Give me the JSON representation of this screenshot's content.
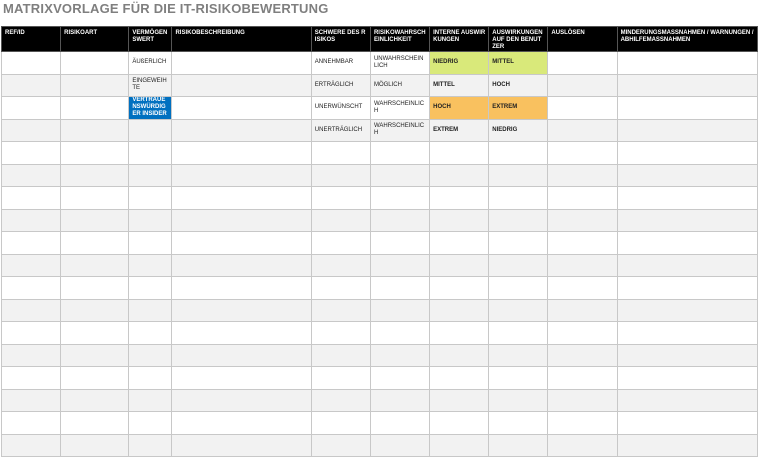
{
  "title": "MATRIXVORLAGE FÜR DIE IT-RISIKOBEWERTUNG",
  "headers": [
    "REF/ID",
    "RISIKOART",
    "VERMÖGENSWERT",
    "RISIKOBESCHREIBUNG",
    "SCHWERE DES RISIKOS",
    "RISIKOWAHRSCHEINLICHKEIT",
    "INTERNE AUSWIRKUNGEN",
    "AUSWIRKUNGEN AUF DEN BENUTZER",
    "AUSLÖSEN",
    "MINDERUNGSMASSNAHMEN / WARNUNGEN / ABHILFEMASSNAHMEN"
  ],
  "column_widths": [
    59,
    68,
    43,
    139,
    59,
    59,
    59,
    59,
    69,
    140
  ],
  "rows": [
    [
      "",
      "",
      "ÄUßERLICH",
      "",
      "ANNEHMBAR",
      "UNWAHRSCHEINLICH",
      "NIEDRIG",
      "MITTEL",
      "",
      ""
    ],
    [
      "",
      "",
      "EINGEWEIHTE",
      "",
      "ERTRÄGLICH",
      "MÖGLICH",
      "MITTEL",
      "HOCH",
      "",
      ""
    ],
    [
      "",
      "",
      "VERTRAUENSWÜRDIGER INSIDER",
      "",
      "UNERWÜNSCHT",
      "WAHRSCHEINLICH",
      "HOCH",
      "EXTREM",
      "",
      ""
    ],
    [
      "",
      "",
      "",
      "",
      "UNERTRÄGLICH",
      "WAHRSCHEINLICH",
      "EXTREM",
      "NIEDRIG",
      "",
      ""
    ],
    [
      "",
      "",
      "",
      "",
      "",
      "",
      "",
      "",
      "",
      ""
    ],
    [
      "",
      "",
      "",
      "",
      "",
      "",
      "",
      "",
      "",
      ""
    ],
    [
      "",
      "",
      "",
      "",
      "",
      "",
      "",
      "",
      "",
      ""
    ],
    [
      "",
      "",
      "",
      "",
      "",
      "",
      "",
      "",
      "",
      ""
    ],
    [
      "",
      "",
      "",
      "",
      "",
      "",
      "",
      "",
      "",
      ""
    ],
    [
      "",
      "",
      "",
      "",
      "",
      "",
      "",
      "",
      "",
      ""
    ],
    [
      "",
      "",
      "",
      "",
      "",
      "",
      "",
      "",
      "",
      ""
    ],
    [
      "",
      "",
      "",
      "",
      "",
      "",
      "",
      "",
      "",
      ""
    ],
    [
      "",
      "",
      "",
      "",
      "",
      "",
      "",
      "",
      "",
      ""
    ],
    [
      "",
      "",
      "",
      "",
      "",
      "",
      "",
      "",
      "",
      ""
    ],
    [
      "",
      "",
      "",
      "",
      "",
      "",
      "",
      "",
      "",
      ""
    ],
    [
      "",
      "",
      "",
      "",
      "",
      "",
      "",
      "",
      "",
      ""
    ],
    [
      "",
      "",
      "",
      "",
      "",
      "",
      "",
      "",
      "",
      ""
    ],
    [
      "",
      "",
      "",
      "",
      "",
      "",
      "",
      "",
      "",
      ""
    ]
  ],
  "cell_styles": {
    "0-6": {
      "bg": "#d9e97a",
      "bold": true
    },
    "0-7": {
      "bg": "#d9e97a",
      "bold": true
    },
    "1-6": {
      "bold": true
    },
    "1-7": {
      "bold": true
    },
    "2-2": {
      "bg": "#0070c0",
      "color": "#ffffff",
      "bold": true
    },
    "2-6": {
      "bg": "#f9c15f",
      "bold": true
    },
    "2-7": {
      "bg": "#f9c15f",
      "bold": true
    },
    "3-6": {
      "bold": true
    },
    "3-7": {
      "bold": true
    }
  }
}
